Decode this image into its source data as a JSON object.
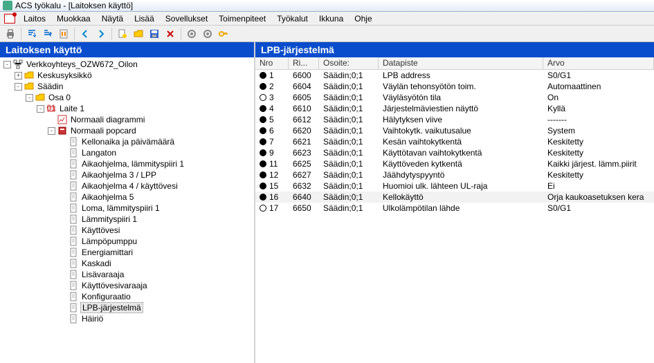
{
  "window": {
    "title": "ACS työkalu - [Laitoksen käyttö]"
  },
  "menu": {
    "items": [
      "Laitos",
      "Muokkaa",
      "Näytä",
      "Lisää",
      "Sovellukset",
      "Toimenpiteet",
      "Työkalut",
      "Ikkuna",
      "Ohje"
    ]
  },
  "left": {
    "title": "Laitoksen käyttö",
    "tree": {
      "root": {
        "label": "Verkkoyhteys_OZW672_Oilon",
        "exp": "-"
      },
      "n1": {
        "label": "Keskusyksikkö",
        "exp": "+"
      },
      "n2": {
        "label": "Säädin",
        "exp": "-"
      },
      "n3": {
        "label": "Osa 0",
        "exp": "-"
      },
      "n4": {
        "label": "Laite 1",
        "exp": "-"
      },
      "n5": {
        "label": "Normaali diagrammi",
        "exp": ""
      },
      "n6": {
        "label": "Normaali popcard",
        "exp": "-"
      },
      "leaves": [
        {
          "label": "Kellonaika ja päivämäärä"
        },
        {
          "label": "Langaton"
        },
        {
          "label": "Aikaohjelma, lämmityspiiri 1"
        },
        {
          "label": "Aikaohjelma 3 / LPP"
        },
        {
          "label": "Aikaohjelma 4 / käyttövesi"
        },
        {
          "label": "Aikaohjelma 5"
        },
        {
          "label": "Loma, lämmityspiiri 1"
        },
        {
          "label": "Lämmityspiiri 1"
        },
        {
          "label": "Käyttövesi"
        },
        {
          "label": "Lämpöpumppu"
        },
        {
          "label": "Energiamittari"
        },
        {
          "label": "Kaskadi"
        },
        {
          "label": "Lisävaraaja"
        },
        {
          "label": "Käyttövesivaraaja"
        },
        {
          "label": "Konfiguraatio"
        },
        {
          "label": "LPB-järjestelmä",
          "sel": true
        },
        {
          "label": "Häiriö"
        }
      ]
    }
  },
  "right": {
    "title": "LPB-järjestelmä",
    "columns": {
      "nro": "Nro",
      "ri": "Ri...",
      "os": "Osoite:",
      "dp": "Datapiste",
      "ar": "Arvo"
    },
    "rows": [
      {
        "dot": "f",
        "n": "1",
        "ri": "6600",
        "os": "Säädin;0;1",
        "dp": "LPB address",
        "ar": "S0/G1"
      },
      {
        "dot": "f",
        "n": "2",
        "ri": "6604",
        "os": "Säädin;0;1",
        "dp": "Väylän tehonsyötön toim.",
        "ar": "Automaattinen"
      },
      {
        "dot": "o",
        "n": "3",
        "ri": "6605",
        "os": "Säädin;0;1",
        "dp": "Väyläsyötön tila",
        "ar": "On"
      },
      {
        "dot": "f",
        "n": "4",
        "ri": "6610",
        "os": "Säädin;0;1",
        "dp": "Järjestelmäviestien näyttö",
        "ar": "Kyllä"
      },
      {
        "dot": "f",
        "n": "5",
        "ri": "6612",
        "os": "Säädin;0;1",
        "dp": "Hälytyksen viive",
        "ar": "-------"
      },
      {
        "dot": "f",
        "n": "6",
        "ri": "6620",
        "os": "Säädin;0;1",
        "dp": "Vaihtokytk. vaikutusalue",
        "ar": "System"
      },
      {
        "dot": "f",
        "n": "7",
        "ri": "6621",
        "os": "Säädin;0;1",
        "dp": "Kesän vaihtokytkentä",
        "ar": "Keskitetty"
      },
      {
        "dot": "f",
        "n": "9",
        "ri": "6623",
        "os": "Säädin;0;1",
        "dp": "Käyttötavan vaihtokytkentä",
        "ar": "Keskitetty"
      },
      {
        "dot": "f",
        "n": "11",
        "ri": "6625",
        "os": "Säädin;0;1",
        "dp": "Käyttöveden kytkentä",
        "ar": "Kaikki järjest. lämm.piirit"
      },
      {
        "dot": "f",
        "n": "12",
        "ri": "6627",
        "os": "Säädin;0;1",
        "dp": "Jäähdytyspyyntö",
        "ar": "Keskitetty"
      },
      {
        "dot": "f",
        "n": "15",
        "ri": "6632",
        "os": "Säädin;0;1",
        "dp": "Huomioi ulk. lähteen UL-raja",
        "ar": "Ei"
      },
      {
        "dot": "f",
        "n": "16",
        "ri": "6640",
        "os": "Säädin;0;1",
        "dp": "Kellokäyttö",
        "ar": "Orja kaukoasetuksen kera",
        "sel": true
      },
      {
        "dot": "o",
        "n": "17",
        "ri": "6650",
        "os": "Säädin;0;1",
        "dp": "Ulkolämpötilan lähde",
        "ar": "S0/G1"
      }
    ]
  }
}
